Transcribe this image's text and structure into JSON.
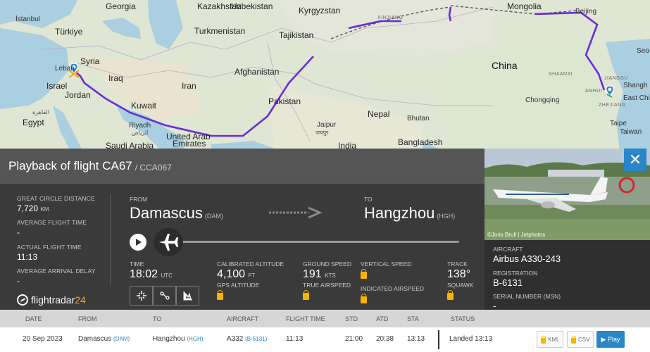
{
  "map": {
    "labels": {
      "georgia": "Georgia",
      "kazakhstan": "Kazakhstan",
      "uzbekistan": "Uzbekistan",
      "kyrgyzstan": "Kyrgyzstan",
      "mongolia": "Mongolia",
      "istanbul": "İstanbul",
      "turkiye": "Türkiye",
      "turkmenistan": "Turkmenistan",
      "tajikistan": "Tajikistan",
      "xinjiang": "XINJIANG",
      "beijing": "Beijing",
      "seoul": "Seo",
      "syria": "Syria",
      "lebanon": "Leban",
      "iraq": "Iraq",
      "afghanistan": "Afghanistan",
      "china": "China",
      "shaanxi": "SHAANXI",
      "jiangsu": "JIANGSU",
      "shanghai": "Shangh",
      "israel": "Israel",
      "jordan": "Jordan",
      "iran": "Iran",
      "kuwait": "Kuwait",
      "pakistan": "Pakistan",
      "anhui": "ANHUI",
      "zhejiang": "ZHEJIANG",
      "east_china": "East Chi",
      "cairo_ar": "القاهرة",
      "egypt": "Egypt",
      "riyadh": "Riyadh",
      "riyadh_ar": "الرياض",
      "nepal": "Nepal",
      "bhutan": "Bhutan",
      "chongqing": "Chongqing",
      "jaipur": "Jaipur",
      "jaipur_hi": "जयपुर",
      "uae_1": "United Arab",
      "uae_2": "Emirates",
      "bangladesh": "Bangladesh",
      "taipei": "Taipe",
      "taiwan": "Taiwan",
      "saudi_arabia": "Saudi Arabia",
      "india": "India"
    }
  },
  "panel": {
    "title": "Playback of flight CA67",
    "callsign": "/ CCA067",
    "great_circle_distance_label": "GREAT CIRCLE DISTANCE",
    "great_circle_distance_value": "7,720",
    "great_circle_distance_unit": "KM",
    "avg_flight_time_label": "AVERAGE FLIGHT TIME",
    "avg_flight_time_value": "-",
    "actual_flight_time_label": "ACTUAL FLIGHT TIME",
    "actual_flight_time_value": "11:13",
    "avg_arrival_delay_label": "AVERAGE ARRIVAL DELAY",
    "avg_arrival_delay_value": "-",
    "logo_text": "flightradar",
    "logo_num": "24",
    "from_label": "FROM",
    "from_city": "Damascus",
    "from_code": "(DAM)",
    "to_label": "TO",
    "to_city": "Hangzhou",
    "to_code": "(HGH)",
    "time_label": "TIME",
    "time_value": "18:02",
    "time_unit": "UTC",
    "cal_alt_label": "CALIBRATED ALTITUDE",
    "cal_alt_value": "4,100",
    "cal_alt_unit": "FT",
    "gps_alt_label": "GPS ALTITUDE",
    "ground_speed_label": "GROUND SPEED",
    "ground_speed_value": "191",
    "ground_speed_unit": "KTS",
    "true_airspeed_label": "TRUE AIRSPEED",
    "vertical_speed_label": "VERTICAL SPEED",
    "indicated_airspeed_label": "INDICATED AIRSPEED",
    "track_label": "TRACK",
    "track_value": "138°",
    "squawk_label": "SQUAWK"
  },
  "aircraft": {
    "credit": "©Joris Brull | Jetphotos",
    "aircraft_label": "AIRCRAFT",
    "aircraft_value": "Airbus A330-243",
    "registration_label": "REGISTRATION",
    "registration_value": "B-6131",
    "serial_label": "SERIAL NUMBER (MSN)",
    "serial_value": "-",
    "close_glyph": "✕"
  },
  "table": {
    "headers": {
      "date": "DATE",
      "from": "FROM",
      "to": "TO",
      "aircraft": "AIRCRAFT",
      "flight_time": "FLIGHT TIME",
      "std": "STD",
      "atd": "ATD",
      "sta": "STA",
      "status": "STATUS"
    },
    "row": {
      "date": "20 Sep 2023",
      "from_city": "Damascus",
      "from_code": "(DAM)",
      "to_city": "Hangzhou",
      "to_code": "(HGH)",
      "aircraft": "A332",
      "registration": "(B-6131)",
      "flight_time": "11:13",
      "std": "21:00",
      "atd": "20:38",
      "sta": "13:13",
      "status": "Landed 13:13",
      "kml": "KML",
      "csv": "CSV",
      "play": "▶ Play"
    }
  },
  "colors": {
    "route": "#6b2bd9",
    "accent": "#2a86c7",
    "lock": "#f5b400"
  }
}
